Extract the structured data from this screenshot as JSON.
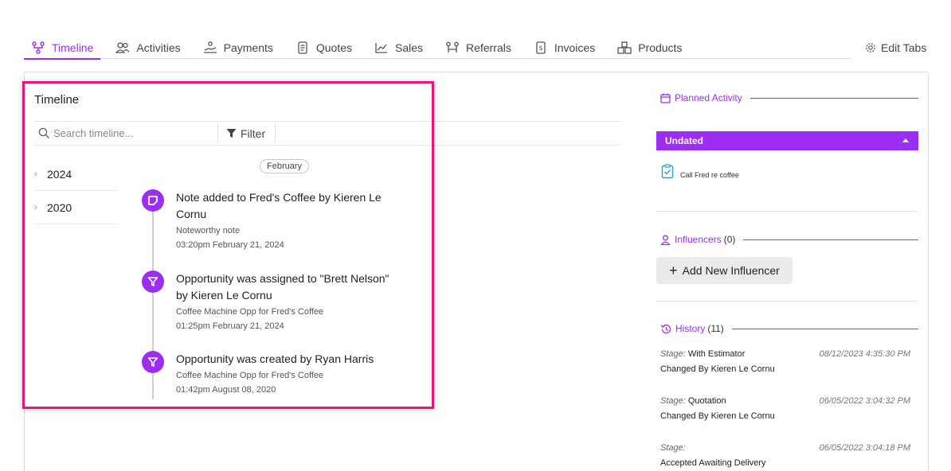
{
  "tabs": [
    {
      "label": "Timeline",
      "icon": "timeline-icon",
      "active": true
    },
    {
      "label": "Activities",
      "icon": "people-icon",
      "active": false
    },
    {
      "label": "Payments",
      "icon": "payment-hand-icon",
      "active": false
    },
    {
      "label": "Quotes",
      "icon": "document-icon",
      "active": false
    },
    {
      "label": "Sales",
      "icon": "chart-line-icon",
      "active": false
    },
    {
      "label": "Referrals",
      "icon": "referral-icon",
      "active": false
    },
    {
      "label": "Invoices",
      "icon": "invoice-icon",
      "active": false
    },
    {
      "label": "Products",
      "icon": "boxes-icon",
      "active": false
    }
  ],
  "edit_tabs_label": "Edit Tabs",
  "timeline": {
    "title": "Timeline",
    "search_placeholder": "Search timeline...",
    "filter_label": "Filter",
    "years": [
      "2024",
      "2020"
    ],
    "month": "February",
    "entries": [
      {
        "icon": "note-icon",
        "title": "Note added to Fred's Coffee by Kieren Le Cornu",
        "subtitle": "Noteworthy note",
        "time": "03:20pm February 21, 2024"
      },
      {
        "icon": "funnel-icon",
        "title": "Opportunity was assigned to \"Brett Nelson\" by Kieren Le Cornu",
        "subtitle": "Coffee Machine Opp for Fred's Coffee",
        "time": "01:25pm February 21, 2024"
      },
      {
        "icon": "funnel-icon",
        "title": "Opportunity was created by Ryan Harris",
        "subtitle": "Coffee Machine Opp for Fred's Coffee",
        "time": "01:42pm August 08, 2020"
      }
    ]
  },
  "planned_activity": {
    "title": "Planned Activity",
    "group_label": "Undated",
    "items": [
      "Call Fred re coffee"
    ]
  },
  "influencers": {
    "title": "Influencers",
    "count": "(0)",
    "add_label": "Add New Influencer"
  },
  "history": {
    "title": "History",
    "count": "(11)",
    "stage_label": "Stage:",
    "items": [
      {
        "stage": "With Estimator",
        "changed_by": "Changed By Kieren Le Cornu",
        "date": "08/12/2023 4:35:30 PM"
      },
      {
        "stage": "Quotation",
        "changed_by": "Changed By Kieren Le Cornu",
        "date": "06/05/2022 3:04:32 PM"
      },
      {
        "stage": "Accepted Awaiting Delivery",
        "changed_by": "",
        "date": "06/05/2022 3:04:18 PM"
      }
    ]
  },
  "colors": {
    "accent": "#9b2ef2",
    "highlight": "#e8157d"
  }
}
